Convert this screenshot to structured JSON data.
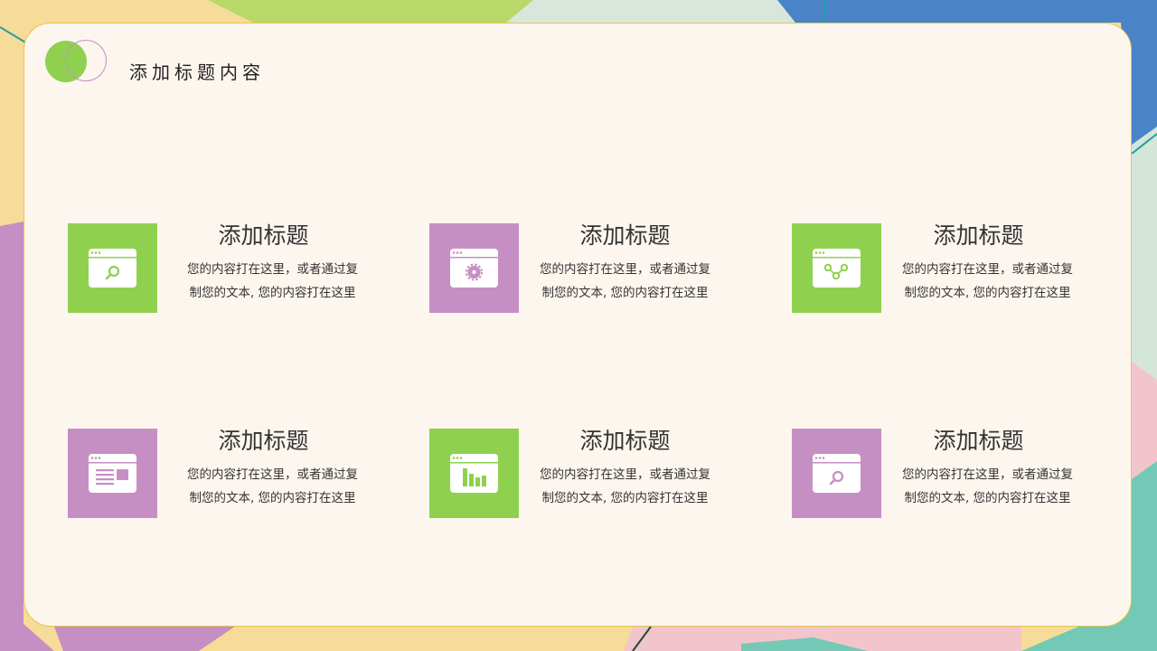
{
  "page": {
    "title": "添加标题内容"
  },
  "colors": {
    "green": "#8fd14f",
    "purple": "#c68fc4",
    "card_bg": "#fdf6ef",
    "card_border": "#e7c64c",
    "blue": "#4a83c8",
    "teal": "#73c9b5",
    "pink": "#f2c4cc",
    "yellow": "#f6dc98"
  },
  "items": [
    {
      "heading": "添加标题",
      "line1": "您的内容打在这里，或者通过复",
      "line2": "制您的文本, 您的内容打在这里",
      "icon": "browser-search-icon",
      "color": "green"
    },
    {
      "heading": "添加标题",
      "line1": "您的内容打在这里，或者通过复",
      "line2": "制您的文本, 您的内容打在这里",
      "icon": "browser-gear-icon",
      "color": "purple"
    },
    {
      "heading": "添加标题",
      "line1": "您的内容打在这里，或者通过复",
      "line2": "制您的文本, 您的内容打在这里",
      "icon": "browser-network-icon",
      "color": "green"
    },
    {
      "heading": "添加标题",
      "line1": "您的内容打在这里，或者通过复",
      "line2": "制您的文本, 您的内容打在这里",
      "icon": "browser-article-icon",
      "color": "purple"
    },
    {
      "heading": "添加标题",
      "line1": "您的内容打在这里，或者通过复",
      "line2": "制您的文本, 您的内容打在这里",
      "icon": "browser-chart-icon",
      "color": "green"
    },
    {
      "heading": "添加标题",
      "line1": "您的内容打在这里，或者通过复",
      "line2": "制您的文本, 您的内容打在这里",
      "icon": "browser-search-icon",
      "color": "purple"
    }
  ]
}
